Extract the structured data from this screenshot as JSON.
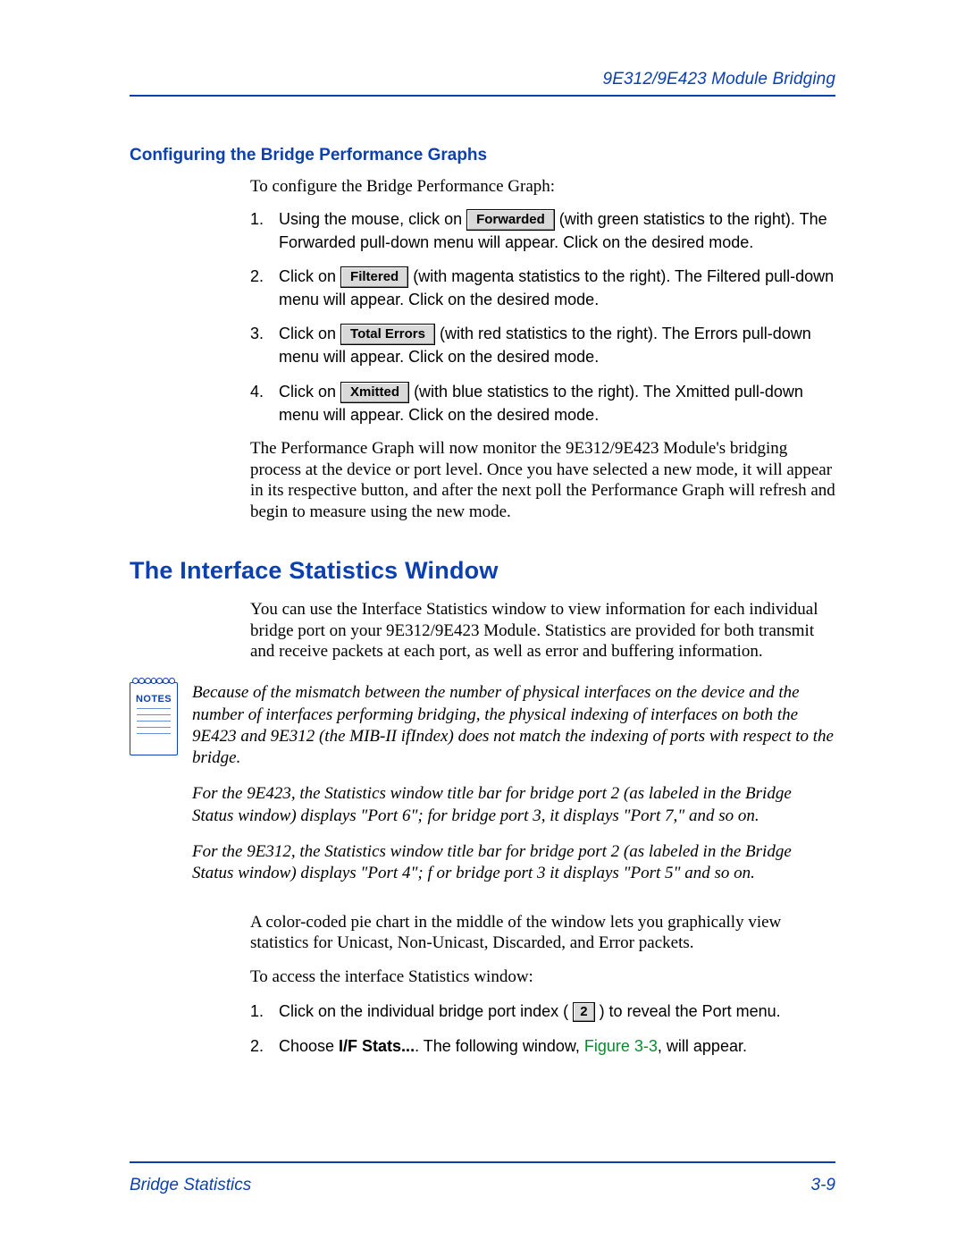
{
  "header": {
    "running_title": "9E312/9E423 Module Bridging"
  },
  "section1": {
    "heading": "Configuring the Bridge Performance Graphs",
    "intro": "To configure the Bridge Performance Graph:",
    "steps": [
      {
        "n": "1.",
        "pre": "Using the mouse, click on ",
        "btn": "Forwarded",
        "post": " (with green statistics to the right). The Forwarded pull-down menu will appear. Click on the desired mode."
      },
      {
        "n": "2.",
        "pre": "Click on ",
        "btn": "Filtered",
        "post": " (with magenta statistics to the right). The Filtered pull-down menu will appear. Click on the desired mode."
      },
      {
        "n": "3.",
        "pre": "Click on ",
        "btn": "Total Errors",
        "post": " (with red statistics to the right). The Errors pull-down menu will appear. Click on the desired mode."
      },
      {
        "n": "4.",
        "pre": "Click on ",
        "btn": "Xmitted",
        "post": " (with blue statistics to the right). The Xmitted pull-down menu will appear. Click on the desired mode."
      }
    ],
    "follow": "The Performance Graph will now monitor the 9E312/9E423 Module's bridging process at the device or port level. Once you have selected a new mode, it will appear in its respective button, and after the next poll the Performance Graph will refresh and begin to measure using the new mode."
  },
  "section2": {
    "heading": "The Interface Statistics Window",
    "intro": "You can use the Interface Statistics window to view information for each individual bridge port on your 9E312/9E423 Module. Statistics are provided for both transmit and receive packets at each port, as well as error and buffering information.",
    "notes_label": "NOTES",
    "notes": [
      "Because of the mismatch between the number of physical interfaces on the device and the number of interfaces performing bridging, the physical indexing of interfaces on both the 9E423 and 9E312 (the MIB-II ifIndex) does not match the indexing of ports with respect to the bridge.",
      "For the 9E423, the Statistics window title bar for bridge port 2 (as labeled in the Bridge Status window) displays \"Port 6\"; for bridge port 3, it displays \"Port 7,\" and so on.",
      "For the 9E312, the Statistics window title bar for bridge port 2 (as labeled in the Bridge Status window) displays \"Port 4\"; f or bridge port 3 it displays \"Port 5\" and so on."
    ],
    "after_notes": "A color-coded pie chart in the middle of the window lets you graphically view statistics for Unicast, Non-Unicast, Discarded, and Error packets.",
    "access_intro": "To access the interface Statistics window:",
    "access_steps": [
      {
        "n": "1.",
        "pre": "Click on the individual bridge port index (",
        "btn": "2",
        "post": ") to reveal the Port menu."
      }
    ],
    "access_step2": {
      "n": "2.",
      "pre": "Choose ",
      "bold": "I/F Stats...",
      "mid": ". The following window, ",
      "link": "Figure 3-3",
      "post": ", will appear."
    }
  },
  "footer": {
    "left": "Bridge Statistics",
    "right": "3-9"
  }
}
